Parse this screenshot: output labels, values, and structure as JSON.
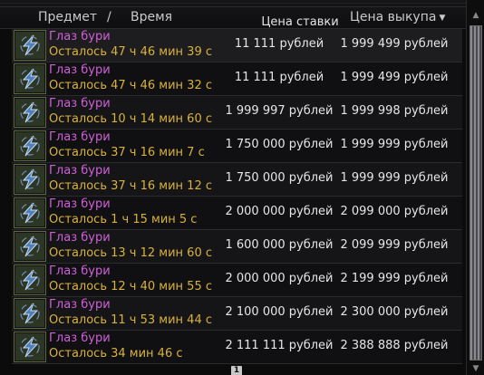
{
  "header": {
    "item_label": "Предмет",
    "separator": "/",
    "time_label": "Время",
    "bid_label": "Цена ставки",
    "buyout_label": "Цена выкупа",
    "sort_indicator": "▼"
  },
  "rows": [
    {
      "name": "Глаз бури",
      "time_left": "Осталось 47 ч 46 мин 39 с",
      "bid": "11 111 рублей",
      "buyout": "1 999 499 рублей"
    },
    {
      "name": "Глаз бури",
      "time_left": "Осталось 47 ч 46 мин 32 с",
      "bid": "11 111 рублей",
      "buyout": "1 999 499 рублей"
    },
    {
      "name": "Глаз бури",
      "time_left": "Осталось 10 ч 14 мин 60 с",
      "bid": "1 999 997 рублей",
      "buyout": "1 999 998 рублей"
    },
    {
      "name": "Глаз бури",
      "time_left": "Осталось 37 ч 16 мин 7 с",
      "bid": "1 750 000 рублей",
      "buyout": "1 999 999 рублей"
    },
    {
      "name": "Глаз бури",
      "time_left": "Осталось 37 ч 16 мин 12 с",
      "bid": "1 750 000 рублей",
      "buyout": "1 999 999 рублей"
    },
    {
      "name": "Глаз бури",
      "time_left": "Осталось 1 ч 15 мин 5 с",
      "bid": "2 000 000 рублей",
      "buyout": "2 099 000 рублей"
    },
    {
      "name": "Глаз бури",
      "time_left": "Осталось 13 ч 12 мин 60 с",
      "bid": "1 600 000 рублей",
      "buyout": "2 099 999 рублей"
    },
    {
      "name": "Глаз бури",
      "time_left": "Осталось 12 ч 40 мин 55 с",
      "bid": "2 000 000 рублей",
      "buyout": "2 199 999 рублей"
    },
    {
      "name": "Глаз бури",
      "time_left": "Осталось 11 ч 53 мин 44 с",
      "bid": "2 100 000 рублей",
      "buyout": "2 300 000 рублей"
    },
    {
      "name": "Глаз бури",
      "time_left": "Осталось 34 мин 46 с",
      "bid": "2 111 111 рублей",
      "buyout": "2 388 888 рублей"
    }
  ],
  "item_icon": "storm-eye-icon",
  "pagination": {
    "current_page": "1"
  },
  "colors": {
    "item_name": "#d060d8",
    "time_left": "#d8b23c",
    "price": "#e6e6e6",
    "header": "#c9c9c9"
  }
}
